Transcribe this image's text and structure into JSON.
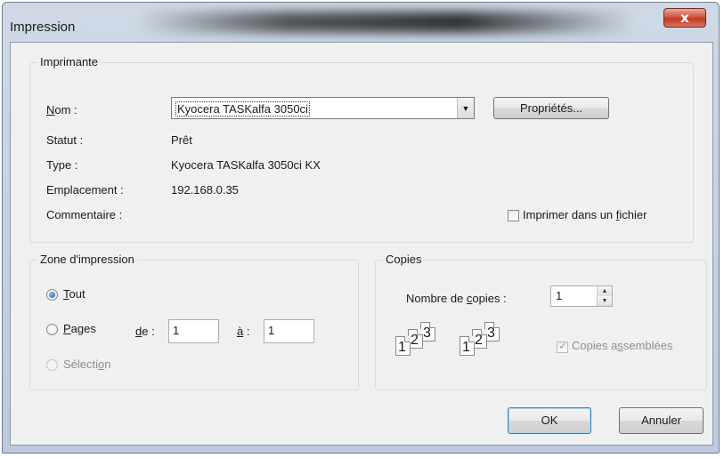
{
  "window": {
    "title": "Impression",
    "close_glyph": "x"
  },
  "printer": {
    "group_label": "Imprimante",
    "name_label": "Nom :",
    "name_value": "Kyocera TASKalfa 3050ci",
    "properties_button": "Propriétés...",
    "status_label": "Statut :",
    "status_value": "Prêt",
    "type_label": "Type :",
    "type_value": "Kyocera TASKalfa 3050ci KX",
    "location_label": "Emplacement :",
    "location_value": "192.168.0.35",
    "comment_label": "Commentaire :",
    "print_to_file": {
      "pre": "Imprimer dans un ",
      "accel": "f",
      "post": "ichier",
      "checked": false
    }
  },
  "print_range": {
    "group_label": "Zone d'impression",
    "all": {
      "accel": "T",
      "rest": "out",
      "checked": true
    },
    "pages": {
      "accel": "P",
      "rest": "ages",
      "checked": false
    },
    "from_label": {
      "accel": "d",
      "rest": "e :"
    },
    "from_value": "1",
    "to_label": {
      "accel": "à",
      "rest": " :"
    },
    "to_value": "1",
    "selection": {
      "pre": "Sélecti",
      "accel": "o",
      "post": "n",
      "enabled": false
    }
  },
  "copies": {
    "group_label": "Copies",
    "count_label": {
      "pre": "Nombre de ",
      "accel": "c",
      "post": "opies :"
    },
    "count_value": "1",
    "collate": {
      "pre": "Copies a",
      "accel": "s",
      "post": "semblées",
      "checked": true,
      "enabled": false
    },
    "collate_icon_digits": [
      "1",
      "2",
      "3"
    ]
  },
  "buttons": {
    "ok": "OK",
    "cancel": "Annuler"
  },
  "icons": {
    "dropdown": "chevron-down-icon",
    "spin_up": "spin-up-icon",
    "spin_down": "spin-down-icon"
  }
}
